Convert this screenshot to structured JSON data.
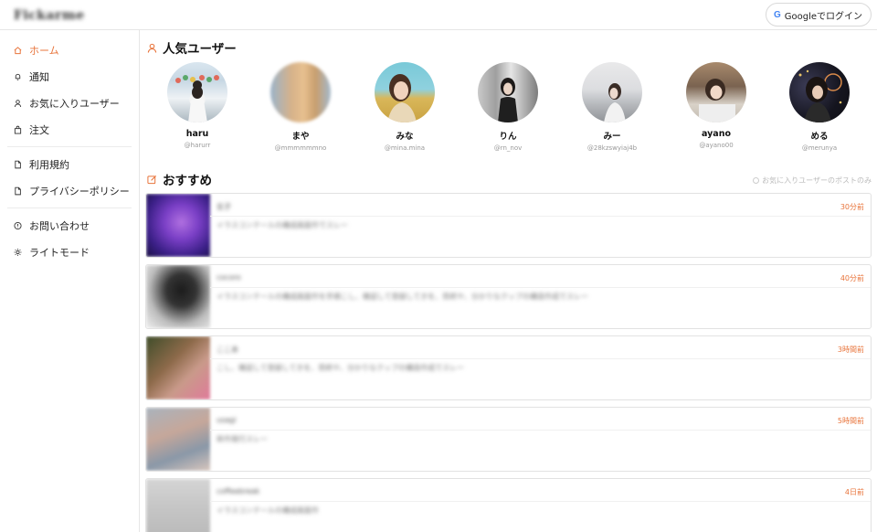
{
  "header": {
    "logo": "Fickarme",
    "login_icon": "google-g",
    "login_icon_glyph": "G",
    "login_label": "Googleでログイン"
  },
  "sidebar": {
    "items": [
      {
        "label": "ホーム",
        "icon": "home-icon",
        "active": true
      },
      {
        "label": "通知",
        "icon": "bell-icon"
      },
      {
        "label": "お気に入りユーザー",
        "icon": "user-icon"
      },
      {
        "label": "注文",
        "icon": "bag-icon"
      },
      {
        "label": "利用規約",
        "icon": "document-icon"
      },
      {
        "label": "プライバシーポリシー",
        "icon": "document-icon"
      },
      {
        "label": "お問い合わせ",
        "icon": "info-circle-icon"
      },
      {
        "label": "ライトモード",
        "icon": "sun-icon"
      }
    ]
  },
  "popular": {
    "title": "人気ユーザー",
    "users": [
      {
        "name": "haru",
        "handle": "@harurr"
      },
      {
        "name": "まや",
        "handle": "@mmmmmmno"
      },
      {
        "name": "みな",
        "handle": "@mina.mina"
      },
      {
        "name": "りん",
        "handle": "@rn_nov"
      },
      {
        "name": "みー",
        "handle": "@28kzswyiaj4b"
      },
      {
        "name": "ayano",
        "handle": "@ayano00"
      },
      {
        "name": "める",
        "handle": "@merunya"
      }
    ]
  },
  "recommended": {
    "title": "おすすめ",
    "filter_label": "お気に入りユーザーのポストのみ",
    "posts": [
      {
        "name": "玄子",
        "text": "イラスコンテールの構成画面作でスレー",
        "time": "30分前"
      },
      {
        "name": "cocoro",
        "text": "イラスコンテールの構成画面作を手順こし、確認して登録してきを、思終や、分かりなクップの構造作成でスレー",
        "time": "40分前"
      },
      {
        "name": "ここあ",
        "text": "こし、確認して登録してきを、思終や、分かりなクップの構造作成でスレー",
        "time": "3時間前"
      },
      {
        "name": "usagi",
        "text": "新作発行スレー",
        "time": "5時間前"
      },
      {
        "name": "coffeebreak",
        "text": "イラスコンテールの構成画面作",
        "time": "4日前"
      }
    ]
  }
}
